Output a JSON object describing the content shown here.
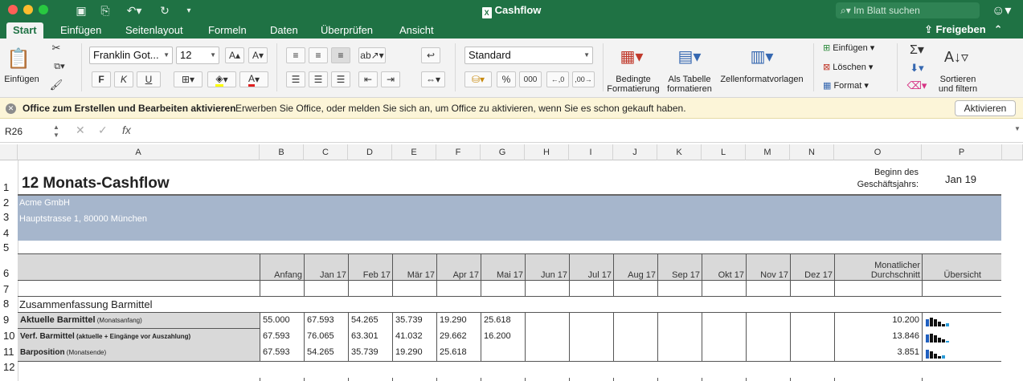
{
  "window": {
    "title": "Cashflow",
    "search_placeholder": "Im Blatt suchen"
  },
  "tabs": [
    "Start",
    "Einfügen",
    "Seitenlayout",
    "Formeln",
    "Daten",
    "Überprüfen",
    "Ansicht"
  ],
  "share_label": "Freigeben",
  "ribbon": {
    "paste_label": "Einfügen",
    "font_name": "Franklin Got...",
    "font_size": "12",
    "bold": "F",
    "italic": "K",
    "underline": "U",
    "number_format": "Standard",
    "percent": "%",
    "thousands": "000",
    "cond_format_l1": "Bedingte",
    "cond_format_l2": "Formatierung",
    "table_format_l1": "Als Tabelle",
    "table_format_l2": "formatieren",
    "cell_styles": "Zellenformatvorlagen",
    "insert": "Einfügen",
    "delete": "Löschen",
    "format": "Format",
    "sort_l1": "Sortieren",
    "sort_l2": "und filtern"
  },
  "infobar": {
    "bold_text": "Office zum Erstellen und Bearbeiten aktivieren",
    "text": "Erwerben Sie Office, oder melden Sie sich an, um Office zu aktivieren, wenn Sie es schon gekauft haben.",
    "button": "Aktivieren"
  },
  "formula_bar": {
    "cell_ref": "R26",
    "fx": "fx",
    "value": ""
  },
  "columns": [
    "A",
    "B",
    "C",
    "D",
    "E",
    "F",
    "G",
    "H",
    "I",
    "J",
    "K",
    "L",
    "M",
    "N",
    "O",
    "P"
  ],
  "rows": [
    "1",
    "2",
    "3",
    "4",
    "5",
    "6",
    "7",
    "8",
    "9",
    "10",
    "11",
    "12"
  ],
  "sheet": {
    "title": "12 Monats-Cashflow",
    "fiscal_label_1": "Beginn des",
    "fiscal_label_2": "Geschäftsjahrs:",
    "fiscal_value": "Jan 19",
    "company": "Acme GmbH",
    "address": "Hauptstrasse 1, 80000 München",
    "header": [
      "Anfang",
      "Jan 17",
      "Feb 17",
      "Mär 17",
      "Apr 17",
      "Mai 17",
      "Jun 17",
      "Jul 17",
      "Aug 17",
      "Sep 17",
      "Okt 17",
      "Nov 17",
      "Dez 17"
    ],
    "avg_header_1": "Monatlicher",
    "avg_header_2": "Durchschnitt",
    "overview_header": "Übersicht",
    "section_title": "Zusammenfassung Barmittel",
    "data_rows": [
      {
        "label": "Aktuelle Barmittel",
        "sub": "(Monatsanfang)",
        "values": [
          "55.000",
          "67.593",
          "54.265",
          "35.739",
          "19.290",
          "25.618"
        ],
        "avg": "10.200"
      },
      {
        "label": "Verf. Barmittel",
        "sub": "(aktuelle + Eingänge vor Auszahlung)",
        "values": [
          "67.593",
          "76.065",
          "63.301",
          "41.032",
          "29.662",
          "16.200"
        ],
        "avg": "13.846"
      },
      {
        "label": "Barposition",
        "sub": "(Monatsende)",
        "values": [
          "67.593",
          "54.265",
          "35.739",
          "19.290",
          "25.618",
          ""
        ],
        "avg": "3.851"
      }
    ]
  },
  "colors": {
    "excel_green": "#1f7244",
    "band": "#a6b6cc",
    "header_grey": "#d9d9d9",
    "spark_blue": "#1f5fbf"
  }
}
